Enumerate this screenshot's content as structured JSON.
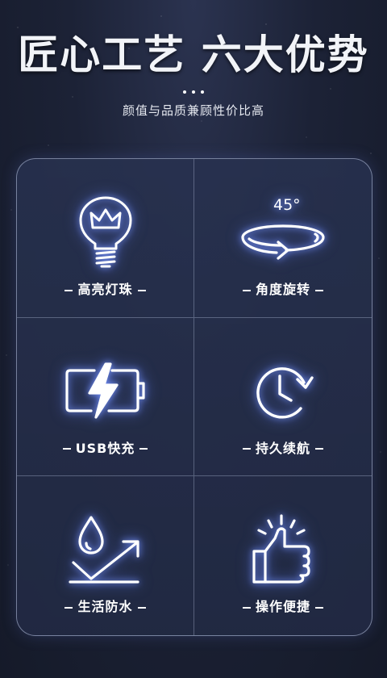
{
  "header": {
    "title": "匠心工艺 六大优势",
    "subtitle": "颜值与品质兼顾性价比高"
  },
  "features": [
    {
      "label": "高亮灯珠",
      "icon": "lightbulb-crown-icon"
    },
    {
      "label": "角度旋转",
      "icon": "rotation-icon",
      "angle_text": "45°"
    },
    {
      "label": "USB快充",
      "icon": "battery-charging-icon"
    },
    {
      "label": "持久续航",
      "icon": "clock-refresh-icon"
    },
    {
      "label": "生活防水",
      "icon": "water-drop-icon"
    },
    {
      "label": "操作便捷",
      "icon": "thumbs-up-icon"
    }
  ],
  "colors": {
    "background": "#1c2236",
    "card": "#28324f",
    "glow": "#7896ff",
    "text": "#ffffff"
  }
}
